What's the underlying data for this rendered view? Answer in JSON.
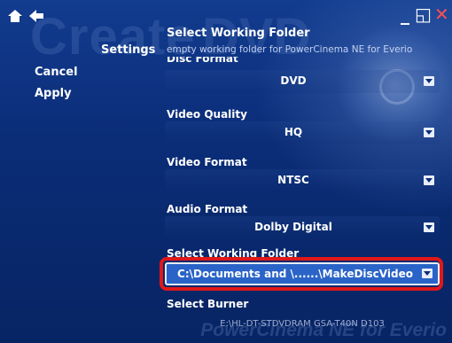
{
  "window": {
    "home_icon": "home-icon",
    "back_icon": "back-arrow-icon",
    "minimize_glyph": "_",
    "restore_glyph": "◱",
    "close_glyph": "✕"
  },
  "watermark": {
    "create": "Create",
    "dvd": "DVD",
    "brand": "PowerCinema NE for Everio"
  },
  "sidebar": {
    "title": "Settings",
    "items": [
      {
        "label": "Cancel"
      },
      {
        "label": "Apply"
      }
    ]
  },
  "header": {
    "title": "Select Working Folder",
    "description": "empty working folder for PowerCinema NE for Everio",
    "cut_label": "Disc Format"
  },
  "fields": {
    "disc_format": {
      "value": "DVD"
    },
    "video_quality": {
      "label": "Video Quality",
      "value": "HQ"
    },
    "video_format": {
      "label": "Video Format",
      "value": "NTSC"
    },
    "audio_format": {
      "label": "Audio Format",
      "value": "Dolby Digital"
    },
    "working_folder": {
      "label": "Select Working Folder",
      "value": "C:\\Documents and \\......\\MakeDiscVideo"
    },
    "burner": {
      "label": "Select Burner",
      "value": "E:\\HL-DT-STDVDRAM GSA-T40N D103"
    }
  },
  "colors": {
    "background": "#0b2d78",
    "highlight": "#2a64c8",
    "ring": "#e01818"
  }
}
